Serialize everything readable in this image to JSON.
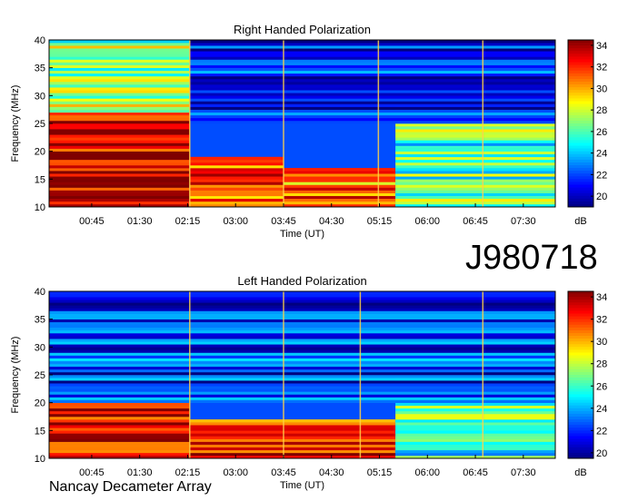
{
  "observation_id": "J980718",
  "observatory": "Nancay Decameter Array",
  "colors": {
    "colormap": [
      "#00007f",
      "#0000ff",
      "#0080ff",
      "#00ffff",
      "#80ff80",
      "#ffff00",
      "#ff8000",
      "#ff0000",
      "#7f0000"
    ]
  },
  "chart_data": [
    {
      "type": "heatmap",
      "title": "Right Handed Polarization",
      "xlabel": "Time (UT)",
      "ylabel": "Frequency (MHz)",
      "x_ticks": [
        "00:45",
        "01:30",
        "02:15",
        "03:00",
        "03:45",
        "04:30",
        "05:15",
        "06:00",
        "06:45",
        "07:30"
      ],
      "x_tick_minutes": [
        45,
        90,
        135,
        180,
        225,
        270,
        315,
        360,
        405,
        450
      ],
      "x_range_minutes": [
        5,
        480
      ],
      "y_ticks": [
        10,
        15,
        20,
        25,
        30,
        35,
        40
      ],
      "ylim": [
        10,
        40
      ],
      "colorbar": {
        "label": "dB",
        "ticks": [
          20,
          22,
          24,
          26,
          28,
          30,
          32,
          34
        ],
        "range": [
          19,
          34.5
        ]
      },
      "vertical_lines_minutes": [
        137,
        225,
        314,
        412
      ],
      "regions": [
        {
          "t_start": 5,
          "t_end": 137,
          "f_low": 10,
          "f_high": 27,
          "level_db": 33
        },
        {
          "t_start": 5,
          "t_end": 137,
          "f_low": 27,
          "f_high": 40,
          "level_db": 27
        },
        {
          "t_start": 137,
          "t_end": 225,
          "f_low": 10,
          "f_high": 19,
          "level_db": 32
        },
        {
          "t_start": 225,
          "t_end": 330,
          "f_low": 10,
          "f_high": 17,
          "level_db": 31
        },
        {
          "t_start": 330,
          "t_end": 480,
          "f_low": 10,
          "f_high": 28,
          "level_db": 26
        },
        {
          "t_start": 137,
          "t_end": 480,
          "f_low": 25,
          "f_high": 40,
          "level_db": 21
        }
      ]
    },
    {
      "type": "heatmap",
      "title": "Left Handed Polarization",
      "xlabel": "Time (UT)",
      "ylabel": "Frequency (MHz)",
      "x_ticks": [
        "00:45",
        "01:30",
        "02:15",
        "03:00",
        "03:45",
        "04:30",
        "05:15",
        "06:00",
        "06:45",
        "07:30"
      ],
      "x_tick_minutes": [
        45,
        90,
        135,
        180,
        225,
        270,
        315,
        360,
        405,
        450
      ],
      "x_range_minutes": [
        5,
        480
      ],
      "y_ticks": [
        10,
        15,
        20,
        25,
        30,
        35,
        40
      ],
      "ylim": [
        10,
        40
      ],
      "colorbar": {
        "label": "dB",
        "ticks": [
          20,
          22,
          24,
          26,
          28,
          30,
          32,
          34
        ],
        "range": [
          19.5,
          34.5
        ]
      },
      "vertical_lines_minutes": [
        137,
        225,
        297,
        412
      ],
      "regions": [
        {
          "t_start": 5,
          "t_end": 137,
          "f_low": 10,
          "f_high": 20,
          "level_db": 33
        },
        {
          "t_start": 137,
          "t_end": 330,
          "f_low": 10,
          "f_high": 17,
          "level_db": 32
        },
        {
          "t_start": 330,
          "t_end": 480,
          "f_low": 10,
          "f_high": 28,
          "level_db": 26
        },
        {
          "t_start": 5,
          "t_end": 480,
          "f_low": 20,
          "f_high": 40,
          "level_db": 22
        }
      ]
    }
  ]
}
